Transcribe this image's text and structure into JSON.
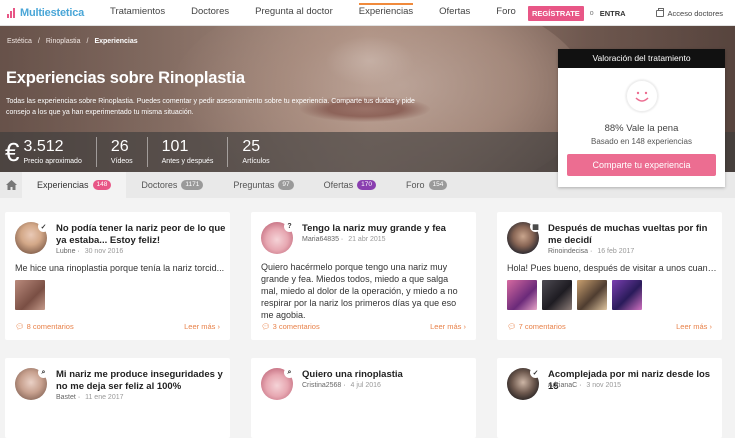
{
  "brand": {
    "logo_text": "Multiestetica",
    "accent": "#e85686",
    "link_color": "#4aa6d7"
  },
  "nav": {
    "items": [
      "Tratamientos",
      "Doctores",
      "Pregunta al doctor",
      "Experiencias",
      "Ofertas",
      "Foro"
    ],
    "active": "Experiencias",
    "register_label": "REGÍSTRATE",
    "separator": "o",
    "enter_label": "ENTRA",
    "doctors_access_label": "Acceso doctores"
  },
  "breadcrumb": {
    "items": [
      "Estética",
      "Rinoplastia",
      "Experiencias"
    ]
  },
  "hero": {
    "title": "Experiencias sobre Rinoplastia",
    "description": "Todas las experiencias sobre Rinoplastia. Puedes comentar y pedir asesoramiento sobre tu experiencia. Comparte tus dudas y pide consejo a los que ya han experimentado tu misma situación."
  },
  "stats": {
    "currency_symbol": "€",
    "price": {
      "value": "3.512",
      "label": "Precio aproximado"
    },
    "videos": {
      "value": "26",
      "label": "Vídeos"
    },
    "before_after": {
      "value": "101",
      "label": "Antes y después"
    },
    "articles": {
      "value": "25",
      "label": "Artículos"
    }
  },
  "rating": {
    "title": "Valoración del tratamiento",
    "percent_text": "88% Vale la pena",
    "based_text": "Basado en 148 experiencias",
    "button_label": "Comparte tu experiencia",
    "icon": "smile-icon"
  },
  "tabs": [
    {
      "label": "Experiencias",
      "count": "148",
      "badge_color": "#e85686",
      "active": true
    },
    {
      "label": "Doctores",
      "count": "1171",
      "badge_color": "#9a9a9a",
      "active": false
    },
    {
      "label": "Preguntas",
      "count": "97",
      "badge_color": "#9a9a9a",
      "active": false
    },
    {
      "label": "Ofertas",
      "count": "170",
      "badge_color": "#8a3fb0",
      "active": false
    },
    {
      "label": "Foro",
      "count": "154",
      "badge_color": "#9a9a9a",
      "active": false
    }
  ],
  "cards": [
    {
      "title": "No podía tener la nariz peor de lo que ya estaba... Estoy feliz!",
      "author": "Lubne",
      "date": "30 nov 2016",
      "body": "Me hice una rinoplastia porque tenía la nariz torcid...",
      "comments": "8 comentarios",
      "more": "Leer más",
      "badge_icon": "check-icon"
    },
    {
      "title": "Tengo la nariz muy grande y fea",
      "author": "Maria64835",
      "date": "21 abr 2015",
      "body": "Quiero hacérmelo porque tengo una nariz muy grande y fea. Miedos todos, miedo a que salga mal, miedo al dolor de la operación, y miedo a no respirar por la nariz los primeros días ya que eso me agobia.",
      "comments": "3 comentarios",
      "more": "Leer más",
      "badge_icon": "question-icon"
    },
    {
      "title": "Después de muchas vueltas por fin me decidí",
      "author": "Rinoindecisa",
      "date": "16 feb 2017",
      "body": "Hola! Pues bueno, después de visitar a unos cuant...",
      "comments": "7 comentarios",
      "more": "Leer más",
      "badge_icon": "calendar-icon"
    },
    {
      "title": "Mi nariz me produce inseguridades y no me deja ser feliz al 100%",
      "author": "Bastet",
      "date": "11 ene 2017",
      "badge_icon": "search-icon"
    },
    {
      "title": "Quiero una rinoplastia",
      "author": "Cristina2568",
      "date": "4 jul 2016",
      "badge_icon": "search-icon"
    },
    {
      "title": "Acomplejada por mi nariz desde los 15",
      "author": "AdrianaC",
      "date": "3 nov 2015",
      "badge_icon": "check-icon"
    }
  ]
}
